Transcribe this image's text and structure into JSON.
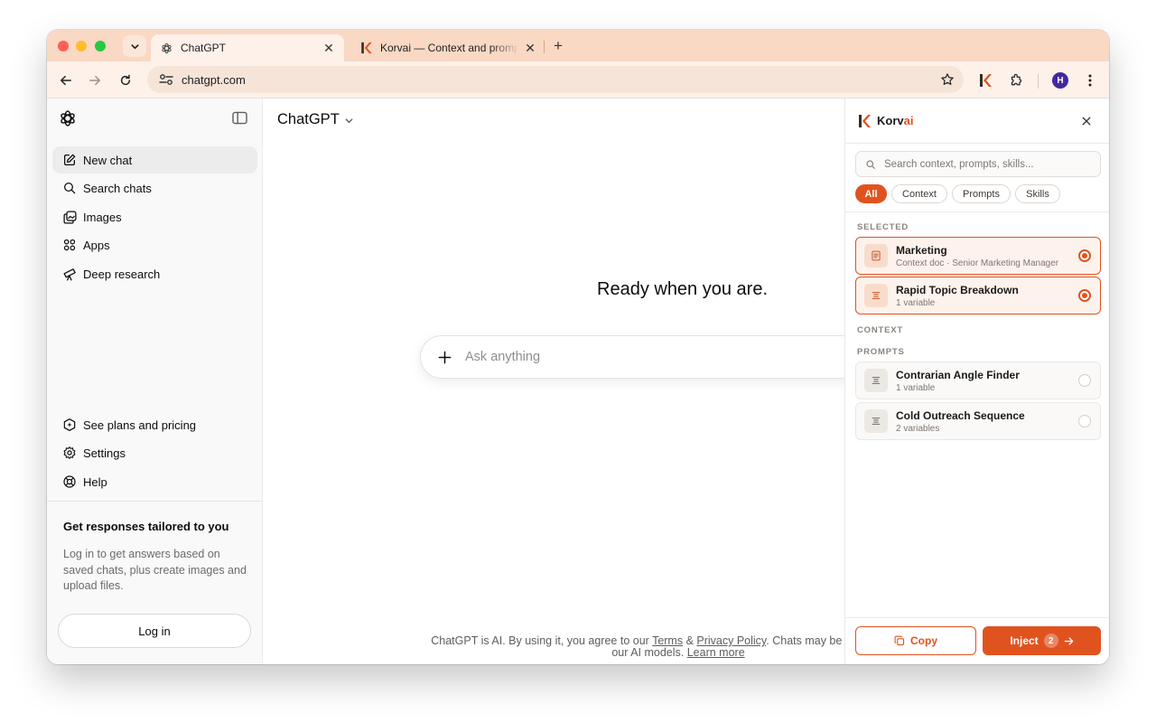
{
  "browser": {
    "tabs": [
      {
        "title": "ChatGPT",
        "active": true
      },
      {
        "title": "Korvai — Context and prompts",
        "active": false
      }
    ],
    "url": "chatgpt.com",
    "profile_initial": "H"
  },
  "sidebar": {
    "items": [
      {
        "label": "New chat",
        "icon": "pencil-square-icon"
      },
      {
        "label": "Search chats",
        "icon": "search-icon"
      },
      {
        "label": "Images",
        "icon": "images-icon"
      },
      {
        "label": "Apps",
        "icon": "apps-grid-icon"
      },
      {
        "label": "Deep research",
        "icon": "telescope-icon"
      }
    ],
    "bottom_items": [
      {
        "label": "See plans and pricing",
        "icon": "plans-badge-icon"
      },
      {
        "label": "Settings",
        "icon": "gear-icon"
      },
      {
        "label": "Help",
        "icon": "lifebuoy-icon"
      }
    ],
    "promo_title": "Get responses tailored to you",
    "promo_text": "Log in to get answers based on saved chats, plus create images and upload files.",
    "login_label": "Log in"
  },
  "main": {
    "model_name": "ChatGPT",
    "hero": "Ready when you are.",
    "composer_placeholder": "Ask anything",
    "footer": {
      "prefix": "ChatGPT is AI. By using it, you agree to our ",
      "terms": "Terms",
      "amp": " & ",
      "privacy": "Privacy Policy",
      "middle": ". Chats may be used to improve our AI models. ",
      "learn_more": "Learn more"
    }
  },
  "korvai": {
    "brand_main": "Korv",
    "brand_accent": "ai",
    "accent_color": "#e0531f",
    "search_placeholder": "Search context, prompts, skills...",
    "filters": [
      "All",
      "Context",
      "Prompts",
      "Skills"
    ],
    "active_filter": "All",
    "sections": {
      "selected": "SELECTED",
      "context": "CONTEXT",
      "prompts": "PROMPTS"
    },
    "selected_items": [
      {
        "title": "Marketing",
        "subtitle": "Context doc · Senior Marketing Manager",
        "icon": "document-icon"
      },
      {
        "title": "Rapid Topic Breakdown",
        "subtitle": "1 variable",
        "icon": "prompt-lines-icon"
      }
    ],
    "prompt_items": [
      {
        "title": "Contrarian Angle Finder",
        "subtitle": "1 variable",
        "icon": "prompt-lines-icon"
      },
      {
        "title": "Cold Outreach Sequence",
        "subtitle": "2 variables",
        "icon": "prompt-lines-icon"
      }
    ],
    "copy_label": "Copy",
    "inject_label": "Inject",
    "inject_count": "2"
  }
}
